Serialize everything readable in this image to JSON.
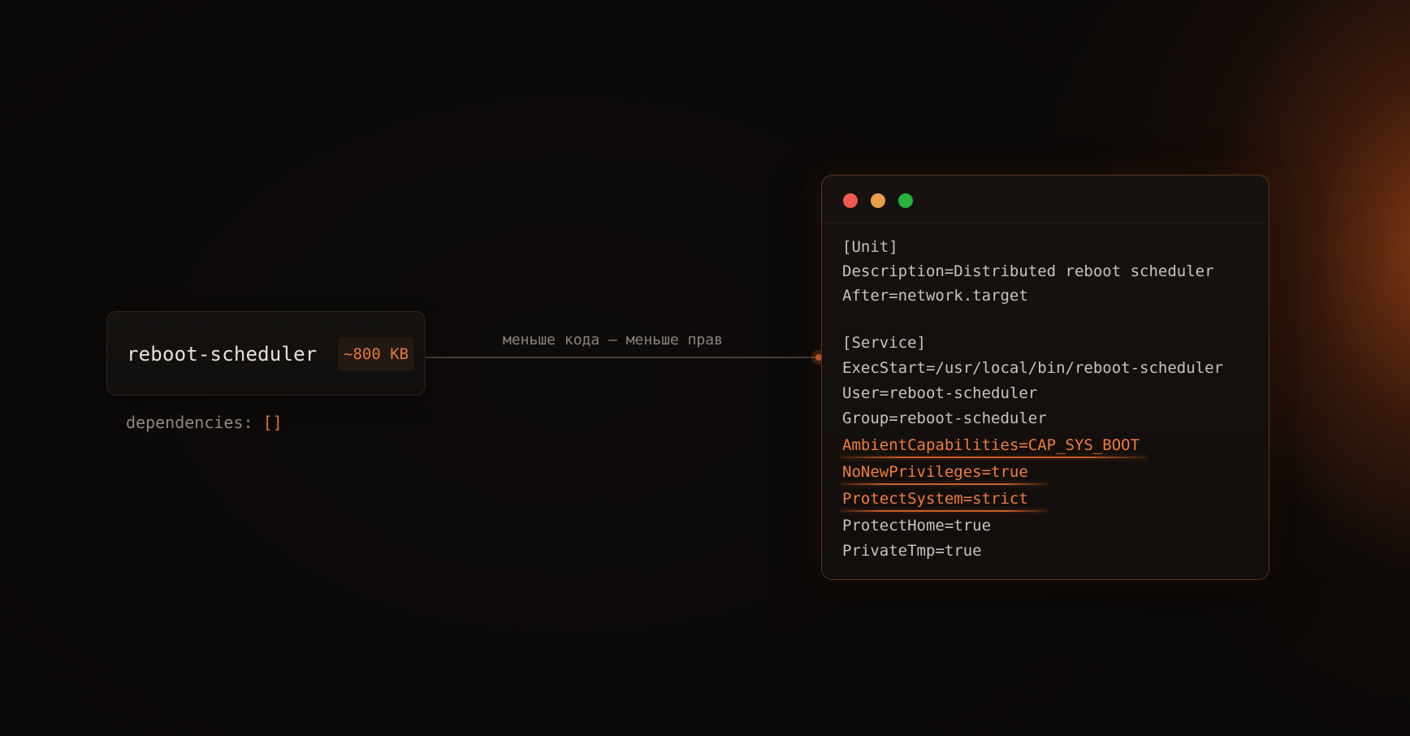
{
  "binary": {
    "name": "reboot-scheduler",
    "size": "~800 KB",
    "dependencies_label": "dependencies: ",
    "dependencies_value": "[]"
  },
  "connector": {
    "label": "меньше кода — меньше прав"
  },
  "window": {
    "lines": [
      {
        "text": "[Unit]",
        "highlight": false
      },
      {
        "text": "Description=Distributed reboot scheduler",
        "highlight": false
      },
      {
        "text": "After=network.target",
        "highlight": false
      },
      {
        "text": "[Service]",
        "highlight": false
      },
      {
        "text": "ExecStart=/usr/local/bin/reboot-scheduler",
        "highlight": false
      },
      {
        "text": "User=reboot-scheduler",
        "highlight": false
      },
      {
        "text": "Group=reboot-scheduler",
        "highlight": false
      },
      {
        "text": "AmbientCapabilities=CAP_SYS_BOOT",
        "highlight": true
      },
      {
        "text": "NoNewPrivileges=true",
        "highlight": true
      },
      {
        "text": "ProtectSystem=strict",
        "highlight": true
      },
      {
        "text": "ProtectHome=true",
        "highlight": false
      },
      {
        "text": "PrivateTmp=true",
        "highlight": false
      }
    ]
  },
  "colors": {
    "accent": "#e0702f",
    "dot_red": "#ee5a4f",
    "dot_yellow": "#e9a04a",
    "dot_green": "#28b33a"
  }
}
